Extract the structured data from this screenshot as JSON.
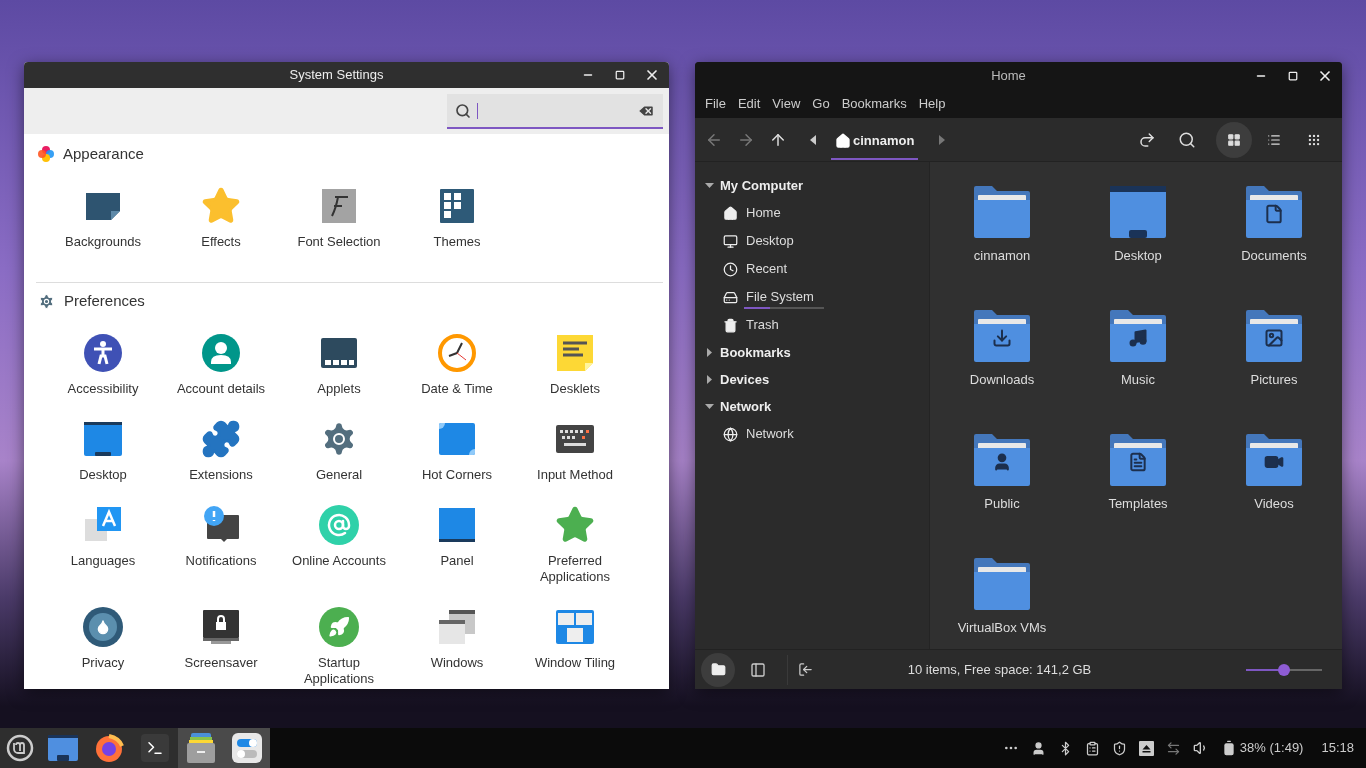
{
  "settings_window": {
    "title": "System Settings",
    "sections": [
      {
        "title": "Appearance",
        "items": [
          "Backgrounds",
          "Effects",
          "Font Selection",
          "Themes"
        ]
      },
      {
        "title": "Preferences",
        "items": [
          "Accessibility",
          "Account details",
          "Applets",
          "Date & Time",
          "Desklets",
          "Desktop",
          "Extensions",
          "General",
          "Hot Corners",
          "Input Method",
          "Languages",
          "Notifications",
          "Online Accounts",
          "Panel",
          "Preferred Applications",
          "Privacy",
          "Screensaver",
          "Startup Applications",
          "Windows",
          "Window Tiling"
        ]
      }
    ]
  },
  "file_manager": {
    "title": "Home",
    "menu": [
      "File",
      "Edit",
      "View",
      "Go",
      "Bookmarks",
      "Help"
    ],
    "path": "cinnamon",
    "view_buttons": [
      {
        "selected": true
      },
      {
        "selected": false
      },
      {
        "selected": false
      }
    ],
    "sidebar": [
      {
        "label": "My Computer",
        "expanded": true,
        "children": [
          {
            "label": "Home"
          },
          {
            "label": "Desktop"
          },
          {
            "label": "Recent"
          },
          {
            "label": "File System",
            "level": 0.33
          },
          {
            "label": "Trash"
          }
        ]
      },
      {
        "label": "Bookmarks",
        "expanded": false
      },
      {
        "label": "Devices",
        "expanded": false
      },
      {
        "label": "Network",
        "expanded": true,
        "children": [
          {
            "label": "Network"
          }
        ]
      }
    ],
    "files": [
      "cinnamon",
      "Desktop",
      "Documents",
      "Downloads",
      "Music",
      "Pictures",
      "Public",
      "Templates",
      "Videos",
      "VirtualBox VMs"
    ],
    "pane_buttons": [
      {
        "selected": true
      },
      {
        "selected": false
      }
    ],
    "status": "10 items, Free space: 141,2 GB",
    "zoom": {
      "level": 0.5
    }
  },
  "taskbar": {
    "launchers": [
      {
        "active": false
      },
      {
        "active": false
      },
      {
        "active": false
      },
      {
        "active": true
      },
      {
        "active": true
      }
    ],
    "battery": "38% (1:49)",
    "clock": "15:18"
  }
}
